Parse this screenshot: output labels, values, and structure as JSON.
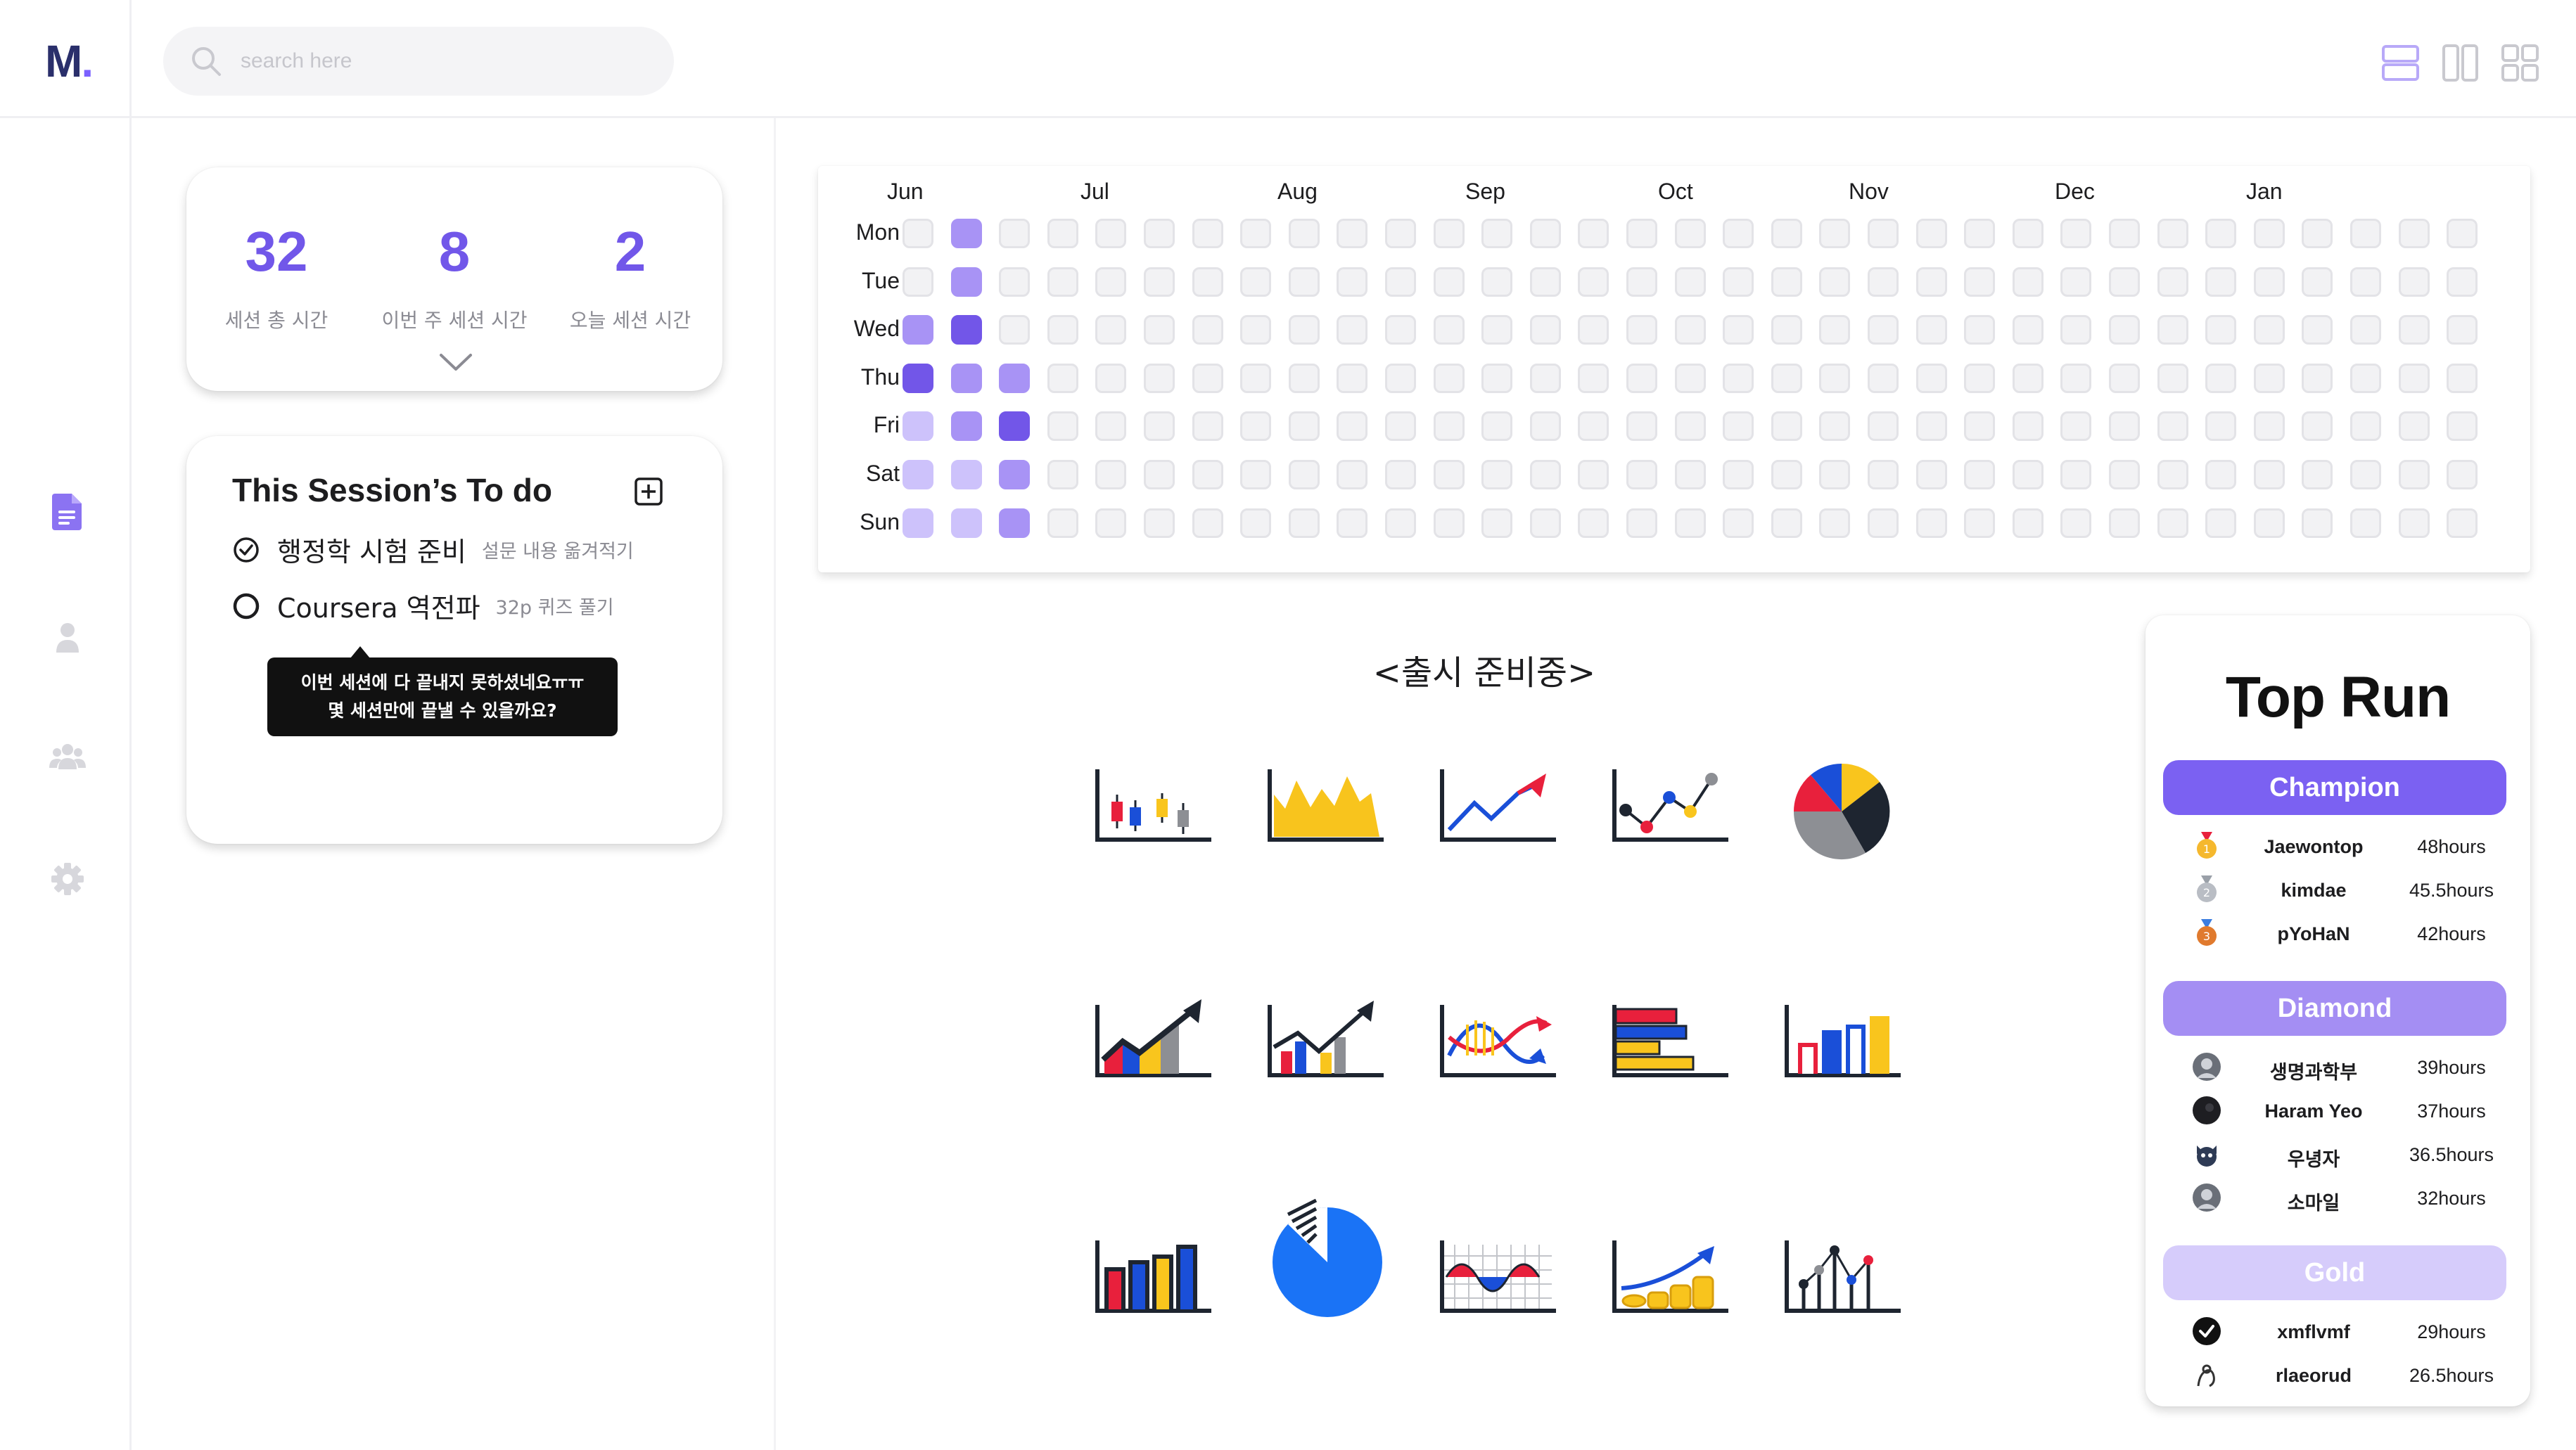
{
  "app": {
    "logo_text": "M",
    "logo_dot": "."
  },
  "search": {
    "placeholder": "search here",
    "value": ""
  },
  "view_toggles": [
    "list-view-icon",
    "columns-view-icon",
    "grid-view-icon"
  ],
  "sidebar": {
    "items": [
      "document-icon",
      "user-icon",
      "group-icon",
      "settings-icon"
    ],
    "active": "document-icon"
  },
  "stats": [
    {
      "value": "32",
      "label": "세션 총 시간"
    },
    {
      "value": "8",
      "label": "이번 주 세션 시간"
    },
    {
      "value": "2",
      "label": "오늘 세션 시간"
    }
  ],
  "todo": {
    "title": "This Session’s To do",
    "items": [
      {
        "text": "행정학 시험 준비",
        "note": "설문 내용 옮겨적기",
        "done": true
      },
      {
        "text": "Coursera 역전파",
        "note": "32p 퀴즈 풀기",
        "done": false
      }
    ],
    "tooltip_line1": "이번 세션에 다 끝내지 못하셨네요ㅠㅠ",
    "tooltip_line2": "몇 세션만에 끝낼 수 있을까요?"
  },
  "heatmap": {
    "months": [
      "Jun",
      "Jul",
      "Aug",
      "Sep",
      "Oct",
      "Nov",
      "Dec",
      "Jan"
    ],
    "days": [
      "Mon",
      "Tue",
      "Wed",
      "Thu",
      "Fri",
      "Sat",
      "Sun"
    ],
    "weeks": 33,
    "levels": [
      [
        0,
        2,
        0
      ],
      [
        0,
        2,
        0
      ],
      [
        2,
        3,
        0
      ],
      [
        3,
        2,
        2
      ],
      [
        1,
        2,
        3
      ],
      [
        1,
        1,
        2
      ],
      [
        1,
        1,
        2
      ]
    ],
    "colors": {
      "empty": "#f2f2f4",
      "l1": "#cdc2fb",
      "l2": "#a893f5",
      "l3": "#7256e8"
    }
  },
  "coming_soon": "<출시 준비중>",
  "chart_icons": [
    "candlestick-chart-icon",
    "area-chart-icon",
    "line-growth-chart-icon",
    "scatter-line-chart-icon",
    "pie-chart-icon",
    "bar-growth-arrow-icon",
    "bar-line-growth-icon",
    "wave-arrow-chart-icon",
    "horizontal-bar-chart-icon",
    "outline-bar-chart-icon",
    "vertical-bar-chart-icon",
    "exploded-pie-chart-icon",
    "grid-wave-chart-icon",
    "coin-growth-chart-icon",
    "stem-plot-chart-icon"
  ],
  "top_run": {
    "title": "Top Run",
    "tiers": [
      {
        "name": "Champion",
        "color": "#7b61f2",
        "entries": [
          {
            "name": "Jaewontop",
            "hours": "48hours",
            "avatar": "gold-medal-icon"
          },
          {
            "name": "kimdae",
            "hours": "45.5hours",
            "avatar": "silver-medal-icon"
          },
          {
            "name": "pYoHaN",
            "hours": "42hours",
            "avatar": "bronze-medal-icon"
          }
        ]
      },
      {
        "name": "Diamond",
        "color": "#a48ef3",
        "entries": [
          {
            "name": "생명과학부",
            "hours": "39hours",
            "avatar": "avatar-photo"
          },
          {
            "name": "Haram Yeo",
            "hours": "37hours",
            "avatar": "avatar-dark"
          },
          {
            "name": "우녕자",
            "hours": "36.5hours",
            "avatar": "avatar-cat"
          },
          {
            "name": "소마일",
            "hours": "32hours",
            "avatar": "avatar-photo"
          }
        ]
      },
      {
        "name": "Gold",
        "color": "#d6ccfb",
        "entries": [
          {
            "name": "xmflvmf",
            "hours": "29hours",
            "avatar": "avatar-check"
          },
          {
            "name": "rlaeorud",
            "hours": "26.5hours",
            "avatar": "avatar-sketch"
          }
        ]
      }
    ]
  }
}
